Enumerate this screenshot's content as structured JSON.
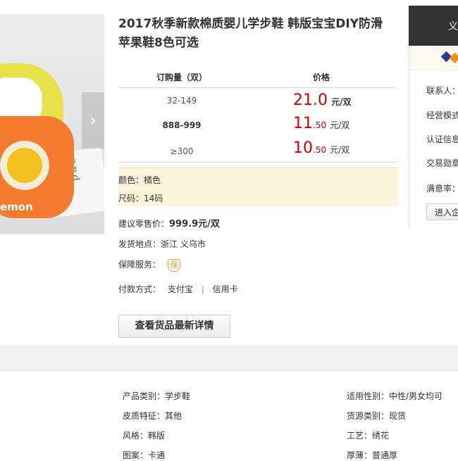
{
  "product": {
    "title_line1": "2017秋季新款棉质婴儿学步鞋 韩版宝宝DIY防滑",
    "title_line2": "苹果鞋8色可选",
    "image_box_text": "and",
    "image_shoe_text": "emon",
    "next_arrow": "›"
  },
  "price_table": {
    "header_qty": "订购量（双）",
    "header_price": "价格",
    "rows": [
      {
        "qty": "32-149",
        "price_int": "21.0",
        "price_dec": "",
        "unit": "元/双"
      },
      {
        "qty": "888-999",
        "price_int": "11",
        "price_dec": ".50",
        "unit": "元/双"
      },
      {
        "qty": "≥300",
        "price_int": "10",
        "price_dec": ".50",
        "unit": "元/双"
      }
    ]
  },
  "specs": {
    "color": "颜色：橘色",
    "size": "尺码：14码"
  },
  "info": {
    "retail_label": "建议零售价：",
    "retail_value": "999.9元/双",
    "ship_label": "发货地点：",
    "ship_value": "浙江 义乌市",
    "guarantee_label": "保障服务：",
    "guarantee_icon_text": "保",
    "payment_label": "付款方式：",
    "payment_option1": "支付宝",
    "payment_separator": "|",
    "payment_option2": "信用卡",
    "details_button": "查看货品最新详情"
  },
  "supplier": {
    "header_text": "义",
    "labels": [
      "联系人：",
      "经营模式",
      "认证信息",
      "交易勋章",
      "满意率："
    ],
    "enter_button": "进入企"
  },
  "attributes": {
    "left": [
      "产品类别：学步鞋",
      "皮质特征：其他",
      "风格：韩版",
      "图案：卡通"
    ],
    "right": [
      "适用性别：中性/男女均可",
      "货源类别：现货",
      "工艺：绣花",
      "厚薄：普通厚"
    ]
  },
  "colors": {
    "price_red": "#cc0000",
    "spec_bg": "#fdf4dc",
    "supplier_header_bg": "#333333",
    "guarantee_orange": "#e29c2a"
  }
}
